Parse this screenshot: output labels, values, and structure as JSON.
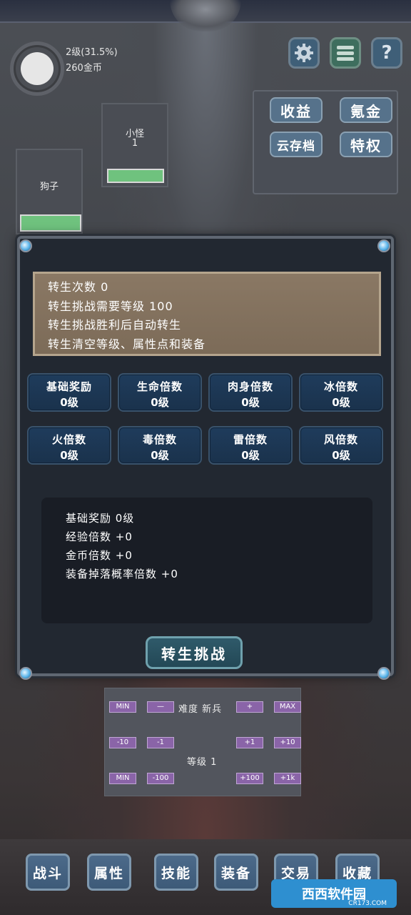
{
  "player": {
    "level": "2级(31.5%)",
    "gold": "260金币",
    "xp_progress": 0.315
  },
  "top_icons": {
    "settings_icon": "gear-icon",
    "menu_icon": "hamburger-icon",
    "help_glyph": "?"
  },
  "shop": {
    "earnings": "收益",
    "topup": "氪金",
    "cloud_save": "云存档",
    "privilege": "特权"
  },
  "monsters": [
    {
      "name": "小怪",
      "sub": "1",
      "hp": 1.0
    },
    {
      "name": "狗子",
      "sub": "",
      "hp": 1.0
    }
  ],
  "rebirth": {
    "info": [
      "转生次数 0",
      "转生挑战需要等级 100",
      "转生挑战胜利后自动转生",
      "转生清空等级、属性点和装备"
    ],
    "multipliers": [
      {
        "title": "基础奖励",
        "value": "0级"
      },
      {
        "title": "生命倍数",
        "value": "0级"
      },
      {
        "title": "肉身倍数",
        "value": "0级"
      },
      {
        "title": "冰倍数",
        "value": "0级"
      },
      {
        "title": "火倍数",
        "value": "0级"
      },
      {
        "title": "毒倍数",
        "value": "0级"
      },
      {
        "title": "雷倍数",
        "value": "0级"
      },
      {
        "title": "风倍数",
        "value": "0级"
      }
    ],
    "details": [
      "基础奖励 0级",
      "经验倍数 +0",
      "金币倍数 +0",
      "装备掉落概率倍数 +0"
    ],
    "challenge_button": "转生挑战"
  },
  "controls": {
    "difficulty_label": "难度 新兵",
    "level_label": "等级 1",
    "row1": [
      "MIN",
      "—",
      "+",
      "MAX"
    ],
    "row2": [
      "-10",
      "-1",
      "+1",
      "+10"
    ],
    "row3": [
      "MIN",
      "-100",
      "+100",
      "+1k"
    ]
  },
  "nav": [
    "战斗",
    "属性",
    "技能",
    "装备",
    "交易",
    "收藏"
  ],
  "watermark": {
    "text": "西西软件园",
    "sub": "CR173.COM"
  }
}
